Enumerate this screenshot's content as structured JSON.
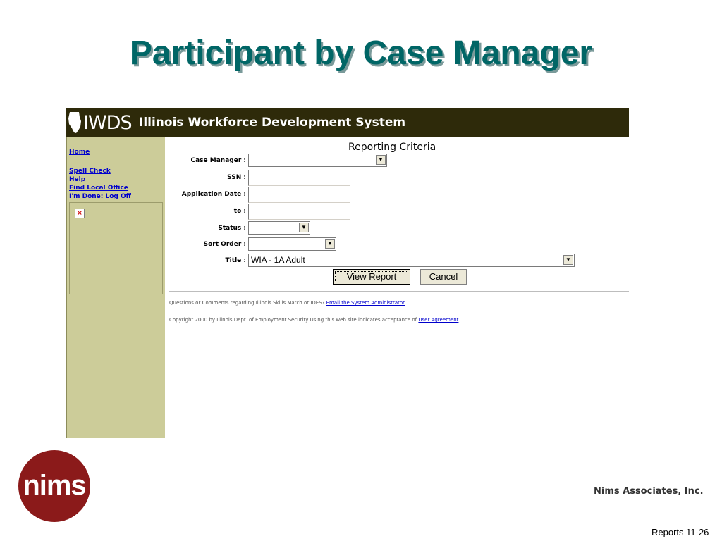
{
  "slide": {
    "title": "Participant by Case Manager",
    "company": "Nims Associates, Inc.",
    "logo_text": "nims",
    "slide_number": "Reports 11-26"
  },
  "colors": {
    "title": "#006666",
    "banner": "#2e2a0a",
    "sidebar": "#cccc99",
    "logo": "#8b1a1a",
    "link": "#0000cc"
  },
  "app": {
    "logo_text": "IWDS",
    "system_title": "Illinois Workforce Development System"
  },
  "sidebar": {
    "home": "Home",
    "links": [
      "Spell Check",
      "Help",
      "Find Local Office",
      "I'm Done: Log Off"
    ],
    "broken_image": "×"
  },
  "form": {
    "heading": "Reporting Criteria",
    "case_manager_label": "Case Manager :",
    "case_manager_value": "",
    "ssn_label": "SSN :",
    "ssn_value": "",
    "app_date_label": "Application Date :",
    "app_date_value": "",
    "to_label": "to :",
    "to_value": "",
    "status_label": "Status :",
    "status_value": "",
    "sort_label": "Sort Order :",
    "sort_value": "",
    "title_label": "Title :",
    "title_value": "WIA - 1A Adult",
    "view_button": "View Report",
    "cancel_button": "Cancel"
  },
  "footer": {
    "questions_text": "Questions or Comments regarding Illinois Skills Match or IDES?",
    "email_link": "Email the System Administrator",
    "copyright_text": "Copyright 2000 by Illinois Dept. of Employment Security Using this web site indicates acceptance of",
    "agreement_link": "User Agreement"
  }
}
